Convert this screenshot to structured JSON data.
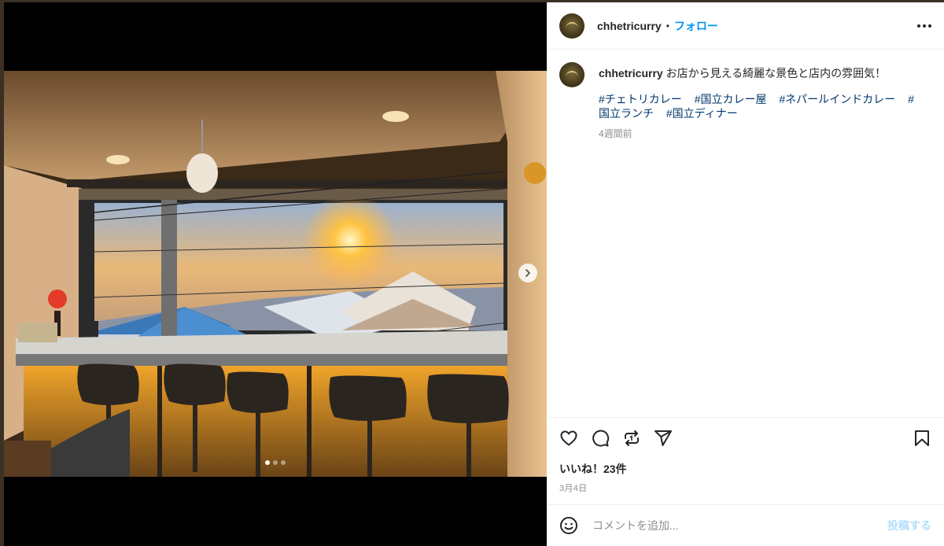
{
  "post": {
    "username": "chhetricurry",
    "separator": "•",
    "follow_label": "フォロー",
    "caption": {
      "username": "chhetricurry",
      "text": "お店から見える綺麗な景色と店内の雰囲気！",
      "hashtags": [
        "#チェトリカレー",
        "#国立カレー屋",
        "#ネパールインドカレー",
        "#国立ランチ",
        "#国立ディナー"
      ],
      "relative_time": "4週間前"
    },
    "likes_text": "いいね！23件",
    "date": "3月4日",
    "comment": {
      "placeholder": "コメントを追加...",
      "post_label": "投稿する"
    },
    "carousel": {
      "total": 3,
      "current": 1
    }
  },
  "icons": [
    "more-icon",
    "heart-icon",
    "comment-icon",
    "share-icon",
    "send-icon",
    "bookmark-icon",
    "emoji-icon",
    "chevron-right-icon"
  ],
  "colors": {
    "link": "#0095f6",
    "hashtag": "#00376b",
    "muted": "#8e8e8e",
    "post_disabled": "#b2dffc"
  }
}
